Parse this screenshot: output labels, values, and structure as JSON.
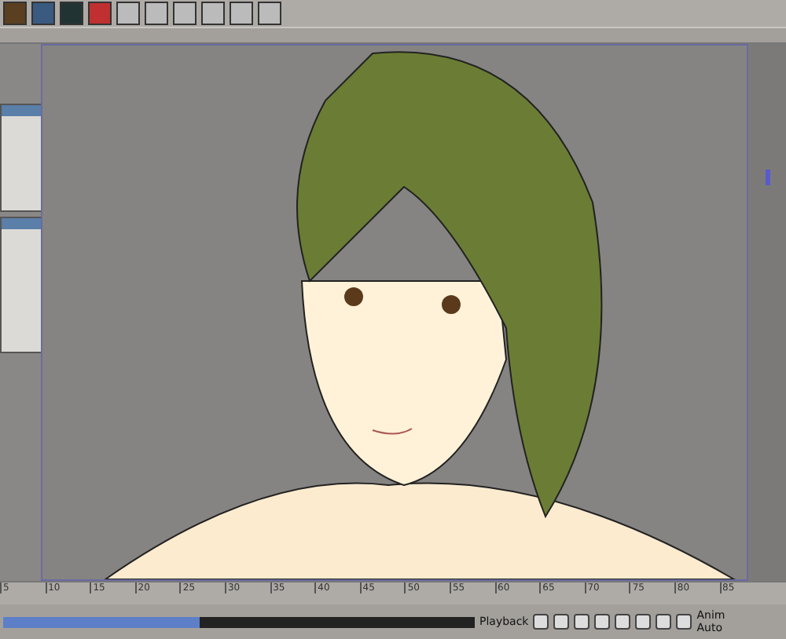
{
  "timeline": {
    "ticks": [
      "5",
      "10",
      "15",
      "20",
      "25",
      "30",
      "35",
      "40",
      "45",
      "50",
      "55",
      "60",
      "65",
      "70",
      "75",
      "80",
      "85"
    ]
  },
  "playback": {
    "label": "Playback"
  },
  "right_panel": {
    "top": "Anim",
    "bottom": "Auto"
  }
}
